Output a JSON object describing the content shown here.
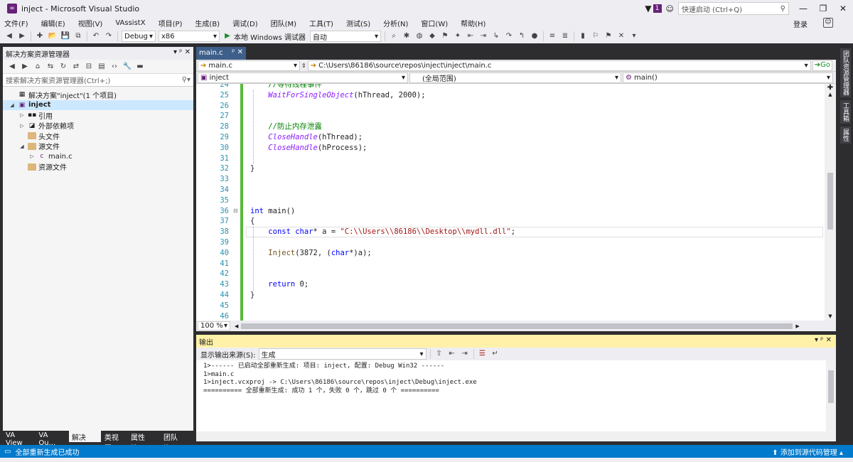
{
  "window": {
    "title": "inject - Microsoft Visual Studio",
    "notif_count": "1",
    "quick_launch_placeholder": "快速启动 (Ctrl+Q)"
  },
  "menu": [
    "文件(F)",
    "编辑(E)",
    "视图(V)",
    "VAssistX",
    "项目(P)",
    "生成(B)",
    "调试(D)",
    "团队(M)",
    "工具(T)",
    "测试(S)",
    "分析(N)",
    "窗口(W)",
    "帮助(H)"
  ],
  "login": "登录",
  "toolbar": {
    "config": "Debug",
    "platform": "x86",
    "run_label": "本地 Windows 调试器",
    "run_mode": "自动"
  },
  "solution_explorer": {
    "title": "解决方案资源管理器",
    "search_placeholder": "搜索解决方案资源管理器(Ctrl+;)",
    "tree": [
      {
        "label": "解决方案\"inject\"(1 个项目)",
        "level": 0,
        "icon": "solution-icon",
        "expander": ""
      },
      {
        "label": "inject",
        "level": 0,
        "icon": "project-icon",
        "expander": "open",
        "selected": true,
        "bold": true
      },
      {
        "label": "引用",
        "level": 1,
        "icon": "references-icon",
        "expander": "closed"
      },
      {
        "label": "外部依赖项",
        "level": 1,
        "icon": "external-deps-icon",
        "expander": "closed"
      },
      {
        "label": "头文件",
        "level": 1,
        "icon": "folder-icon",
        "expander": ""
      },
      {
        "label": "源文件",
        "level": 1,
        "icon": "folder-icon",
        "expander": "open"
      },
      {
        "label": "main.c",
        "level": 2,
        "icon": "c-file-icon",
        "expander": "closed"
      },
      {
        "label": "资源文件",
        "level": 1,
        "icon": "folder-icon",
        "expander": ""
      }
    ],
    "bottom_tabs": [
      "VA View",
      "VA Ou...",
      "解决方...",
      "类视图",
      "属性管...",
      "团队资..."
    ]
  },
  "editor": {
    "tab": "main.c",
    "nav_file": "main.c",
    "nav_path": "C:\\Users\\86186\\source\\repos\\inject\\inject\\main.c",
    "go_label": "Go",
    "scope_project": "inject",
    "scope_global": "(全局范围)",
    "scope_function": "main()",
    "zoom": "100 %",
    "lines": [
      {
        "n": "24",
        "text": "    //等待线程事件"
      },
      {
        "n": "25",
        "text": "    WaitForSingleObject(hThread, 2000);"
      },
      {
        "n": "26",
        "text": ""
      },
      {
        "n": "27",
        "text": ""
      },
      {
        "n": "28",
        "text": "    //防止内存泄露"
      },
      {
        "n": "29",
        "text": "    CloseHandle(hThread);"
      },
      {
        "n": "30",
        "text": "    CloseHandle(hProcess);"
      },
      {
        "n": "31",
        "text": ""
      },
      {
        "n": "32",
        "text": "}"
      },
      {
        "n": "33",
        "text": ""
      },
      {
        "n": "34",
        "text": ""
      },
      {
        "n": "35",
        "text": ""
      },
      {
        "n": "36",
        "text": "int main()"
      },
      {
        "n": "37",
        "text": "{"
      },
      {
        "n": "38",
        "text": "    const char* a = \"C:\\\\Users\\\\86186\\\\Desktop\\\\mydll.dll\";"
      },
      {
        "n": "39",
        "text": ""
      },
      {
        "n": "40",
        "text": "    Inject(3872, (char*)a);"
      },
      {
        "n": "41",
        "text": ""
      },
      {
        "n": "42",
        "text": ""
      },
      {
        "n": "43",
        "text": "    return 0;"
      },
      {
        "n": "44",
        "text": "}"
      },
      {
        "n": "45",
        "text": ""
      },
      {
        "n": "46",
        "text": ""
      }
    ]
  },
  "output": {
    "title": "输出",
    "source_label": "显示输出来源(S):",
    "source_value": "生成",
    "lines": [
      "1>------ 已启动全部重新生成: 项目: inject, 配置: Debug Win32 ------",
      "1>main.c",
      "1>inject.vcxproj -> C:\\Users\\86186\\source\\repos\\inject\\Debug\\inject.exe",
      "========== 全部重新生成: 成功 1 个，失败 0 个，跳过 0 个 =========="
    ]
  },
  "side_tabs": [
    "团队资源管理器",
    "工具箱",
    "属性"
  ],
  "status": {
    "left": "全部重新生成已成功",
    "right": "添加到源代码管理"
  }
}
